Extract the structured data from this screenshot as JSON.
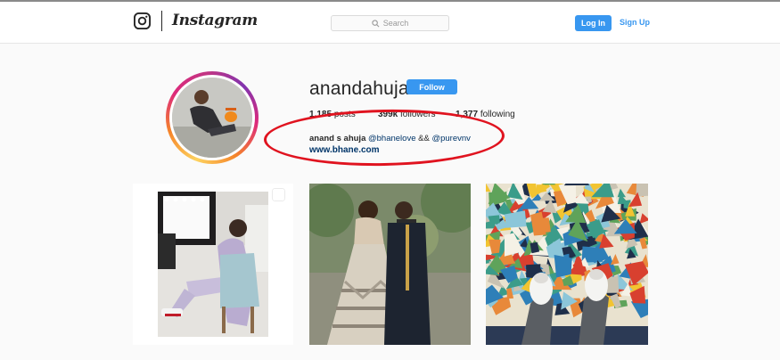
{
  "header": {
    "brand": "Instagram",
    "search_placeholder": "Search",
    "login_label": "Log In",
    "signup_label": "Sign Up",
    "accent_color": "#3897f0"
  },
  "profile": {
    "username": "anandahuja",
    "follow_label": "Follow",
    "stats": {
      "posts_count": "1,185",
      "posts_label": "posts",
      "followers_count": "399k",
      "followers_label": "followers",
      "following_count": "1,377",
      "following_label": "following"
    },
    "bio": {
      "name": "anand s ahuja",
      "mention_1": "@bhanelove",
      "separator": "&&",
      "mention_2": "@purevnv",
      "website": "www.bhane.com"
    }
  },
  "annotation": {
    "type": "red-oval",
    "color": "#e0131f"
  },
  "posts": [
    {
      "description": "woman in lavender tracksuit on chair",
      "multi": true
    },
    {
      "description": "couple in formal wear",
      "multi": false
    },
    {
      "description": "mosaic floor with sneakers",
      "multi": false
    }
  ]
}
